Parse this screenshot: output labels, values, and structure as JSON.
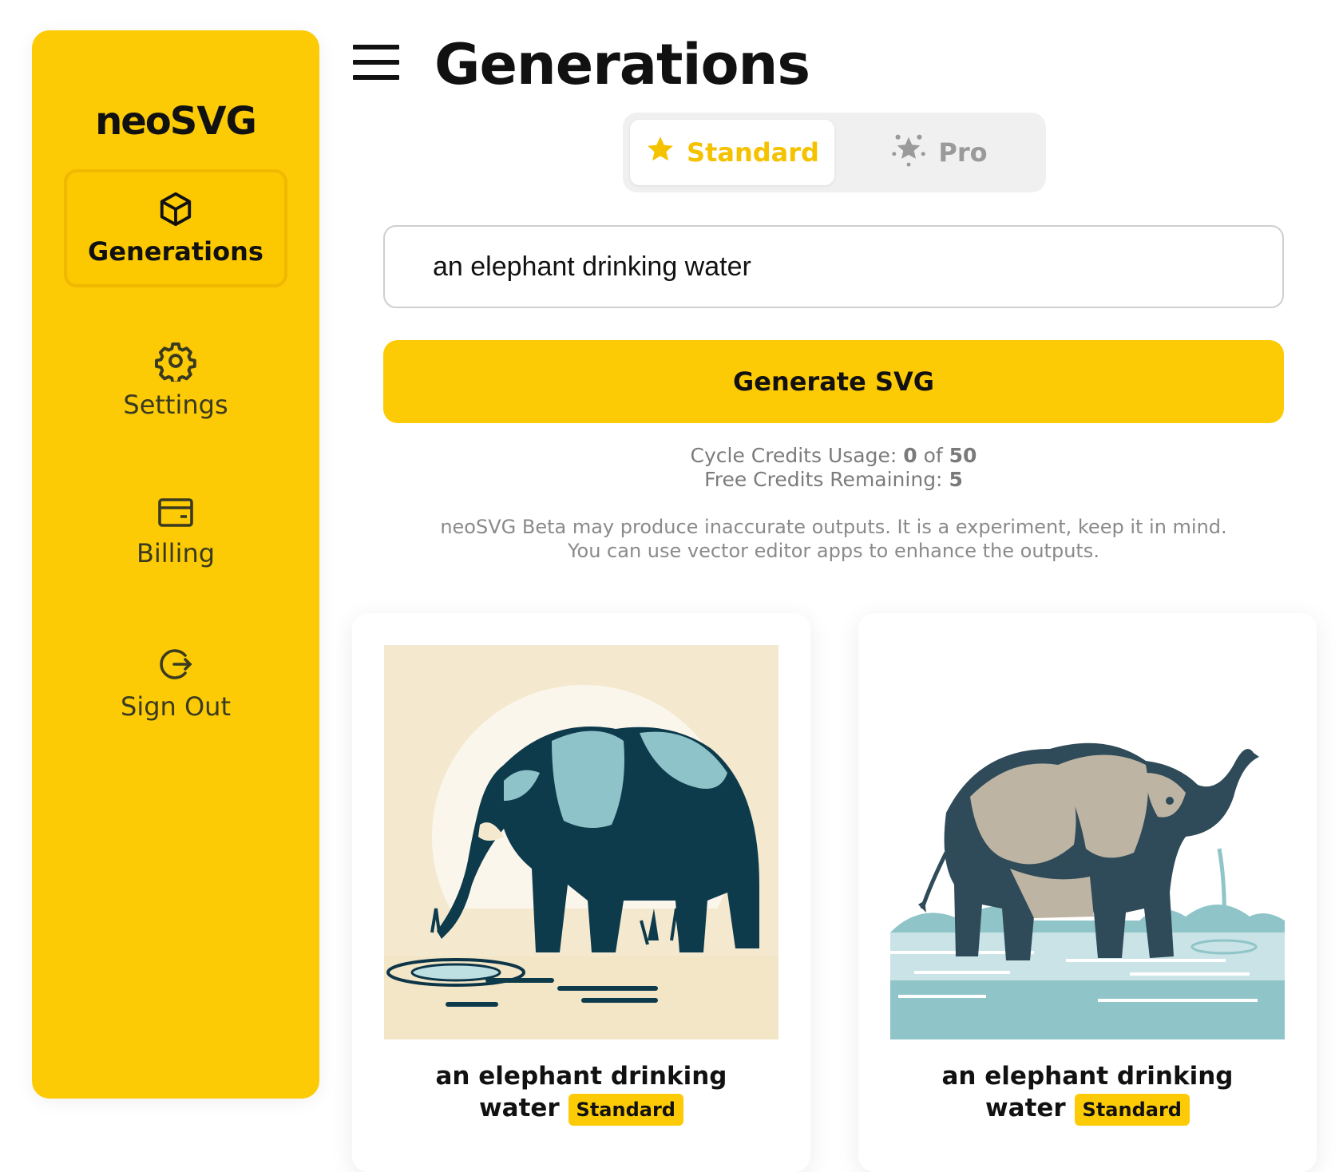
{
  "app": {
    "logo_prefix": "neo",
    "logo_suffix": "SVG",
    "accent_color": "#fccb06"
  },
  "sidebar": {
    "items": [
      {
        "label": "Generations",
        "icon": "cube-icon",
        "active": true
      },
      {
        "label": "Settings",
        "icon": "gear-icon",
        "active": false
      },
      {
        "label": "Billing",
        "icon": "wallet-icon",
        "active": false
      },
      {
        "label": "Sign Out",
        "icon": "sign-out-icon",
        "active": false
      }
    ]
  },
  "header": {
    "title": "Generations",
    "menu_icon": "hamburger-menu-icon"
  },
  "tiers": {
    "standard": {
      "label": "Standard",
      "icon": "star-icon",
      "selected": true
    },
    "pro": {
      "label": "Pro",
      "icon": "sparkle-stars-icon",
      "selected": false
    }
  },
  "prompt": {
    "value": "an elephant drinking water"
  },
  "generate_button": {
    "label": "Generate SVG"
  },
  "credits": {
    "cycle_label": "Cycle Credits Usage:",
    "cycle_used": "0",
    "cycle_of": "of",
    "cycle_total": "50",
    "free_label": "Free Credits Remaining:",
    "free_remaining": "5"
  },
  "disclaimer": {
    "line1": "neoSVG Beta may produce inaccurate outputs. It is a experiment, keep it in mind.",
    "line2": "You can use vector editor apps to enhance the outputs."
  },
  "generations": [
    {
      "title_line1": "an elephant drinking",
      "title_line2": "water",
      "badge": "Standard",
      "image": "elephant-drinking-illustration-1"
    },
    {
      "title_line1": "an elephant drinking",
      "title_line2": "water",
      "badge": "Standard",
      "image": "elephant-drinking-illustration-2"
    }
  ]
}
